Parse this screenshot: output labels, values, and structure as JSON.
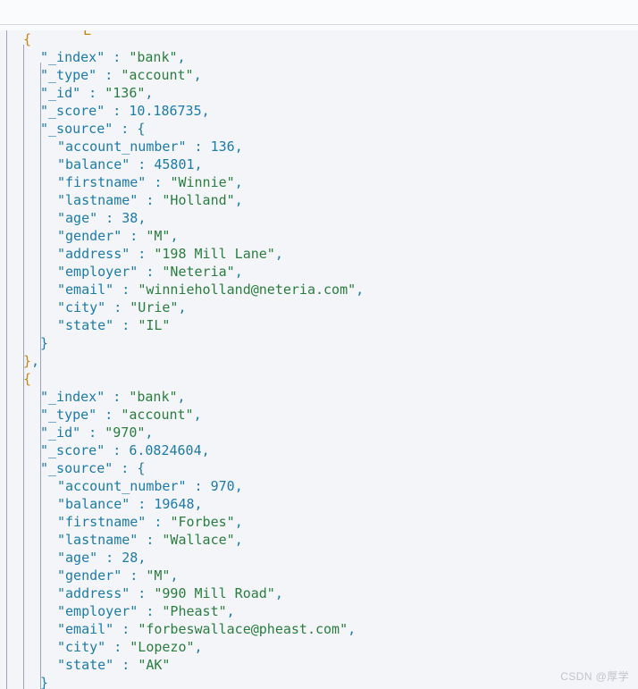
{
  "viewer": {
    "title": "JSON Response Viewer",
    "language": "json",
    "font_size_px": 15,
    "line_height_px": 20,
    "indent_spaces": 2,
    "colors": {
      "background": "#f4f5f9",
      "toolbar_background": "#fafbfc",
      "divider": "#d3d7e3",
      "indent_guide": "#9aa3bb",
      "key": "#1c7ba8",
      "string": "#2a7d3f",
      "number": "#1c7ba8",
      "punctuation": "#1c7ba8",
      "brace_outer": "#c9870a",
      "brace_inner": "#1c7ba8",
      "watermark": "#c2c4cc"
    }
  },
  "watermark": {
    "text": "CSDN @厚学"
  },
  "clipped_glyph_above": "L",
  "hits": [
    {
      "_index": "bank",
      "_type": "account",
      "_id": "136",
      "_score": "10.186735",
      "_source": {
        "account_number": "136",
        "balance": "45801",
        "firstname": "Winnie",
        "lastname": "Holland",
        "age": "38",
        "gender": "M",
        "address": "198 Mill Lane",
        "employer": "Neteria",
        "email": "winnieholland@neteria.com",
        "city": "Urie",
        "state": "IL"
      }
    },
    {
      "_index": "bank",
      "_type": "account",
      "_id": "970",
      "_score": "6.0824604",
      "_source": {
        "account_number": "970",
        "balance": "19648",
        "firstname": "Forbes",
        "lastname": "Wallace",
        "age": "28",
        "gender": "M",
        "address": "990 Mill Road",
        "employer": "Pheast",
        "email": "forbeswallace@pheast.com",
        "city": "Lopezo",
        "state": "AK"
      }
    }
  ],
  "rendered_lines": [
    {
      "indent": 1,
      "tokens": [
        {
          "t": "{",
          "c": "b1"
        }
      ]
    },
    {
      "indent": 2,
      "tokens": [
        {
          "t": "\"_index\"",
          "c": "k"
        },
        {
          "t": " : ",
          "c": "p"
        },
        {
          "t": "\"bank\"",
          "c": "s"
        },
        {
          "t": ",",
          "c": "p"
        }
      ]
    },
    {
      "indent": 2,
      "tokens": [
        {
          "t": "\"_type\"",
          "c": "k"
        },
        {
          "t": " : ",
          "c": "p"
        },
        {
          "t": "\"account\"",
          "c": "s"
        },
        {
          "t": ",",
          "c": "p"
        }
      ]
    },
    {
      "indent": 2,
      "tokens": [
        {
          "t": "\"_id\"",
          "c": "k"
        },
        {
          "t": " : ",
          "c": "p"
        },
        {
          "t": "\"136\"",
          "c": "s"
        },
        {
          "t": ",",
          "c": "p"
        }
      ]
    },
    {
      "indent": 2,
      "tokens": [
        {
          "t": "\"_score\"",
          "c": "k"
        },
        {
          "t": " : ",
          "c": "p"
        },
        {
          "t": "10.186735",
          "c": "n"
        },
        {
          "t": ",",
          "c": "p"
        }
      ]
    },
    {
      "indent": 2,
      "tokens": [
        {
          "t": "\"_source\"",
          "c": "k"
        },
        {
          "t": " : ",
          "c": "p"
        },
        {
          "t": "{",
          "c": "b2"
        }
      ]
    },
    {
      "indent": 3,
      "tokens": [
        {
          "t": "\"account_number\"",
          "c": "k"
        },
        {
          "t": " : ",
          "c": "p"
        },
        {
          "t": "136",
          "c": "n"
        },
        {
          "t": ",",
          "c": "p"
        }
      ]
    },
    {
      "indent": 3,
      "tokens": [
        {
          "t": "\"balance\"",
          "c": "k"
        },
        {
          "t": " : ",
          "c": "p"
        },
        {
          "t": "45801",
          "c": "n"
        },
        {
          "t": ",",
          "c": "p"
        }
      ]
    },
    {
      "indent": 3,
      "tokens": [
        {
          "t": "\"firstname\"",
          "c": "k"
        },
        {
          "t": " : ",
          "c": "p"
        },
        {
          "t": "\"Winnie\"",
          "c": "s"
        },
        {
          "t": ",",
          "c": "p"
        }
      ]
    },
    {
      "indent": 3,
      "tokens": [
        {
          "t": "\"lastname\"",
          "c": "k"
        },
        {
          "t": " : ",
          "c": "p"
        },
        {
          "t": "\"Holland\"",
          "c": "s"
        },
        {
          "t": ",",
          "c": "p"
        }
      ]
    },
    {
      "indent": 3,
      "tokens": [
        {
          "t": "\"age\"",
          "c": "k"
        },
        {
          "t": " : ",
          "c": "p"
        },
        {
          "t": "38",
          "c": "n"
        },
        {
          "t": ",",
          "c": "p"
        }
      ]
    },
    {
      "indent": 3,
      "tokens": [
        {
          "t": "\"gender\"",
          "c": "k"
        },
        {
          "t": " : ",
          "c": "p"
        },
        {
          "t": "\"M\"",
          "c": "s"
        },
        {
          "t": ",",
          "c": "p"
        }
      ]
    },
    {
      "indent": 3,
      "tokens": [
        {
          "t": "\"address\"",
          "c": "k"
        },
        {
          "t": " : ",
          "c": "p"
        },
        {
          "t": "\"198 Mill Lane\"",
          "c": "s"
        },
        {
          "t": ",",
          "c": "p"
        }
      ]
    },
    {
      "indent": 3,
      "tokens": [
        {
          "t": "\"employer\"",
          "c": "k"
        },
        {
          "t": " : ",
          "c": "p"
        },
        {
          "t": "\"Neteria\"",
          "c": "s"
        },
        {
          "t": ",",
          "c": "p"
        }
      ]
    },
    {
      "indent": 3,
      "tokens": [
        {
          "t": "\"email\"",
          "c": "k"
        },
        {
          "t": " : ",
          "c": "p"
        },
        {
          "t": "\"winnieholland@neteria.com\"",
          "c": "s"
        },
        {
          "t": ",",
          "c": "p"
        }
      ]
    },
    {
      "indent": 3,
      "tokens": [
        {
          "t": "\"city\"",
          "c": "k"
        },
        {
          "t": " : ",
          "c": "p"
        },
        {
          "t": "\"Urie\"",
          "c": "s"
        },
        {
          "t": ",",
          "c": "p"
        }
      ]
    },
    {
      "indent": 3,
      "tokens": [
        {
          "t": "\"state\"",
          "c": "k"
        },
        {
          "t": " : ",
          "c": "p"
        },
        {
          "t": "\"IL\"",
          "c": "s"
        }
      ]
    },
    {
      "indent": 2,
      "tokens": [
        {
          "t": "}",
          "c": "b2"
        }
      ]
    },
    {
      "indent": 1,
      "tokens": [
        {
          "t": "}",
          "c": "b1"
        },
        {
          "t": ",",
          "c": "p"
        }
      ]
    },
    {
      "indent": 1,
      "tokens": [
        {
          "t": "{",
          "c": "b1"
        }
      ]
    },
    {
      "indent": 2,
      "tokens": [
        {
          "t": "\"_index\"",
          "c": "k"
        },
        {
          "t": " : ",
          "c": "p"
        },
        {
          "t": "\"bank\"",
          "c": "s"
        },
        {
          "t": ",",
          "c": "p"
        }
      ]
    },
    {
      "indent": 2,
      "tokens": [
        {
          "t": "\"_type\"",
          "c": "k"
        },
        {
          "t": " : ",
          "c": "p"
        },
        {
          "t": "\"account\"",
          "c": "s"
        },
        {
          "t": ",",
          "c": "p"
        }
      ]
    },
    {
      "indent": 2,
      "tokens": [
        {
          "t": "\"_id\"",
          "c": "k"
        },
        {
          "t": " : ",
          "c": "p"
        },
        {
          "t": "\"970\"",
          "c": "s"
        },
        {
          "t": ",",
          "c": "p"
        }
      ]
    },
    {
      "indent": 2,
      "tokens": [
        {
          "t": "\"_score\"",
          "c": "k"
        },
        {
          "t": " : ",
          "c": "p"
        },
        {
          "t": "6.0824604",
          "c": "n"
        },
        {
          "t": ",",
          "c": "p"
        }
      ]
    },
    {
      "indent": 2,
      "tokens": [
        {
          "t": "\"_source\"",
          "c": "k"
        },
        {
          "t": " : ",
          "c": "p"
        },
        {
          "t": "{",
          "c": "b2"
        }
      ]
    },
    {
      "indent": 3,
      "tokens": [
        {
          "t": "\"account_number\"",
          "c": "k"
        },
        {
          "t": " : ",
          "c": "p"
        },
        {
          "t": "970",
          "c": "n"
        },
        {
          "t": ",",
          "c": "p"
        }
      ]
    },
    {
      "indent": 3,
      "tokens": [
        {
          "t": "\"balance\"",
          "c": "k"
        },
        {
          "t": " : ",
          "c": "p"
        },
        {
          "t": "19648",
          "c": "n"
        },
        {
          "t": ",",
          "c": "p"
        }
      ]
    },
    {
      "indent": 3,
      "tokens": [
        {
          "t": "\"firstname\"",
          "c": "k"
        },
        {
          "t": " : ",
          "c": "p"
        },
        {
          "t": "\"Forbes\"",
          "c": "s"
        },
        {
          "t": ",",
          "c": "p"
        }
      ]
    },
    {
      "indent": 3,
      "tokens": [
        {
          "t": "\"lastname\"",
          "c": "k"
        },
        {
          "t": " : ",
          "c": "p"
        },
        {
          "t": "\"Wallace\"",
          "c": "s"
        },
        {
          "t": ",",
          "c": "p"
        }
      ]
    },
    {
      "indent": 3,
      "tokens": [
        {
          "t": "\"age\"",
          "c": "k"
        },
        {
          "t": " : ",
          "c": "p"
        },
        {
          "t": "28",
          "c": "n"
        },
        {
          "t": ",",
          "c": "p"
        }
      ]
    },
    {
      "indent": 3,
      "tokens": [
        {
          "t": "\"gender\"",
          "c": "k"
        },
        {
          "t": " : ",
          "c": "p"
        },
        {
          "t": "\"M\"",
          "c": "s"
        },
        {
          "t": ",",
          "c": "p"
        }
      ]
    },
    {
      "indent": 3,
      "tokens": [
        {
          "t": "\"address\"",
          "c": "k"
        },
        {
          "t": " : ",
          "c": "p"
        },
        {
          "t": "\"990 Mill Road\"",
          "c": "s"
        },
        {
          "t": ",",
          "c": "p"
        }
      ]
    },
    {
      "indent": 3,
      "tokens": [
        {
          "t": "\"employer\"",
          "c": "k"
        },
        {
          "t": " : ",
          "c": "p"
        },
        {
          "t": "\"Pheast\"",
          "c": "s"
        },
        {
          "t": ",",
          "c": "p"
        }
      ]
    },
    {
      "indent": 3,
      "tokens": [
        {
          "t": "\"email\"",
          "c": "k"
        },
        {
          "t": " : ",
          "c": "p"
        },
        {
          "t": "\"forbeswallace@pheast.com\"",
          "c": "s"
        },
        {
          "t": ",",
          "c": "p"
        }
      ]
    },
    {
      "indent": 3,
      "tokens": [
        {
          "t": "\"city\"",
          "c": "k"
        },
        {
          "t": " : ",
          "c": "p"
        },
        {
          "t": "\"Lopezo\"",
          "c": "s"
        },
        {
          "t": ",",
          "c": "p"
        }
      ]
    },
    {
      "indent": 3,
      "tokens": [
        {
          "t": "\"state\"",
          "c": "k"
        },
        {
          "t": " : ",
          "c": "p"
        },
        {
          "t": "\"AK\"",
          "c": "s"
        }
      ]
    },
    {
      "indent": 2,
      "tokens": [
        {
          "t": "}",
          "c": "b2"
        }
      ]
    }
  ]
}
